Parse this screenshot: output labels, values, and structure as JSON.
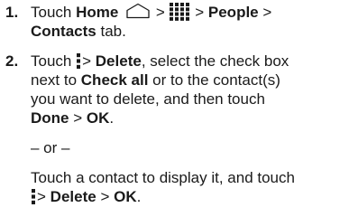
{
  "step1": {
    "number": "1.",
    "touch": "Touch",
    "home": "Home",
    "gt1": ">",
    "gt2": ">",
    "people": "People",
    "gt3": ">",
    "contacts": "Contacts",
    "tab": "tab.",
    "icons": {
      "home": "home-icon",
      "apps": "apps-grid-icon"
    }
  },
  "step2": {
    "number": "2.",
    "touch": "Touch",
    "gt1": ">",
    "delete": "Delete",
    "line1_rest": ", select the check box",
    "line2_a": "next to",
    "check_all": "Check all",
    "line2_b": "or to the contact(s)",
    "line3": "you want to delete, and then touch",
    "done": "Done",
    "gt2": ">",
    "ok": "OK",
    "period": ".",
    "or": "– or –",
    "alt_line1": "Touch a contact to display it, and touch",
    "alt_gt1": ">",
    "alt_delete": "Delete",
    "alt_gt2": ">",
    "alt_ok": "OK",
    "alt_period": ".",
    "icons": {
      "menu": "menu-icon"
    }
  }
}
